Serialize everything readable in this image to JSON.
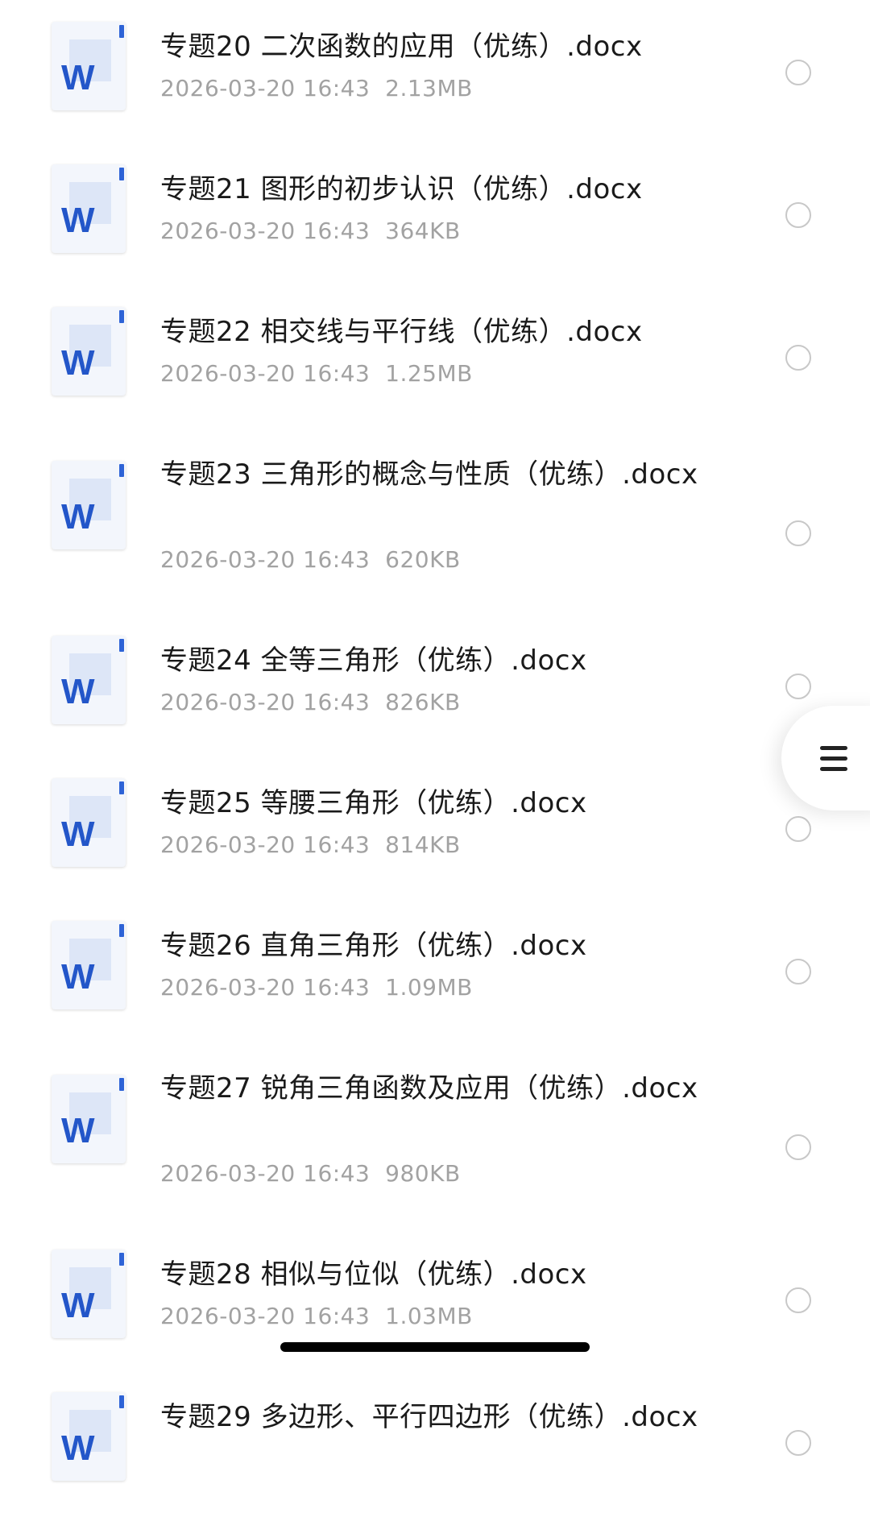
{
  "files": [
    {
      "name": "专题20 二次函数的应用（优练）.docx",
      "date": "2026-03-20 16:43",
      "size": "2.13MB",
      "icon": "word-doc-icon"
    },
    {
      "name": "专题21 图形的初步认识（优练）.docx",
      "date": "2026-03-20 16:43",
      "size": "364KB",
      "icon": "word-doc-icon"
    },
    {
      "name": "专题22 相交线与平行线（优练）.docx",
      "date": "2026-03-20 16:43",
      "size": "1.25MB",
      "icon": "word-doc-icon"
    },
    {
      "name": "专题23 三角形的概念与性质（优练）.docx",
      "date": "2026-03-20 16:43",
      "size": "620KB",
      "icon": "word-doc-icon"
    },
    {
      "name": "专题24 全等三角形（优练）.docx",
      "date": "2026-03-20 16:43",
      "size": "826KB",
      "icon": "word-doc-icon"
    },
    {
      "name": "专题25 等腰三角形（优练）.docx",
      "date": "2026-03-20 16:43",
      "size": "814KB",
      "icon": "word-doc-icon"
    },
    {
      "name": "专题26 直角三角形（优练）.docx",
      "date": "2026-03-20 16:43",
      "size": "1.09MB",
      "icon": "word-doc-icon"
    },
    {
      "name": "专题27 锐角三角函数及应用（优练）.docx",
      "date": "2026-03-20 16:43",
      "size": "980KB",
      "icon": "word-doc-icon"
    },
    {
      "name": "专题28 相似与位似（优练）.docx",
      "date": "2026-03-20 16:43",
      "size": "1.03MB",
      "icon": "word-doc-icon"
    },
    {
      "name": "专题29 多边形、平行四边形（优练）.docx",
      "date": "",
      "size": "",
      "icon": "word-doc-icon"
    }
  ],
  "icon_letter": "W",
  "menu_button": {
    "icon": "hamburger-menu-icon"
  },
  "colors": {
    "word_blue": "#2356c9",
    "meta_gray": "#a2a2a2",
    "name_text": "#1a1a1a"
  }
}
